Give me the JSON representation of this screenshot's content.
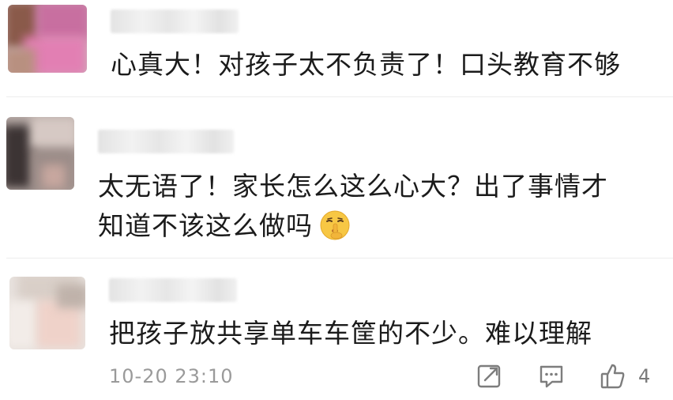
{
  "comments": [
    {
      "username": "",
      "text": "心真大！对孩子太不负责了！口头教育不够"
    },
    {
      "username": "",
      "text_line1": "太无语了！家长怎么这么心大？出了事情才",
      "text_line2": "知道不该这么做吗",
      "emoji": "shush-face-emoji"
    },
    {
      "username": "",
      "text": "把孩子放共享单车车筐的不少。难以理解",
      "timestamp": "10-20 23:10",
      "like_count": "4"
    }
  ],
  "icons": {
    "share": "share-icon",
    "reply": "comment-icon",
    "like": "thumbs-up-icon"
  },
  "colors": {
    "text": "#1b1b1b",
    "meta": "#9a9a9a",
    "emoji_face": "#f7c744"
  }
}
